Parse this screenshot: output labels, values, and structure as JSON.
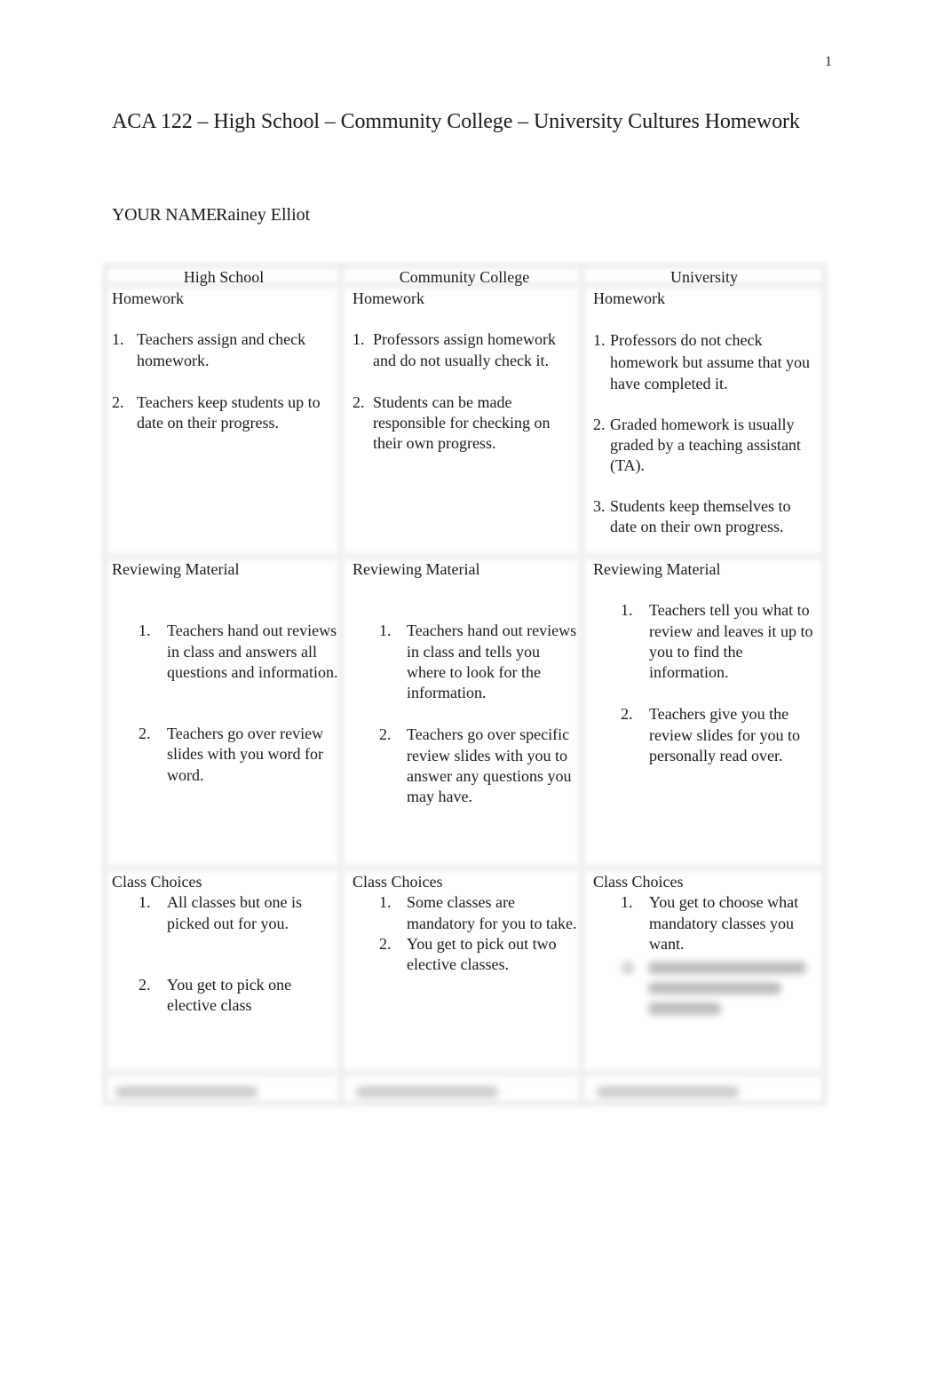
{
  "page_number": "1",
  "title": "ACA 122 – High School – Community College – University Cultures Homework",
  "name_label": "YOUR NAME:",
  "name_value": "Rainey Elliot",
  "table": {
    "columns": [
      "High School",
      "Community College",
      "University"
    ],
    "rows": [
      {
        "section": "Homework",
        "cells": [
          [
            "Teachers assign and check homework.",
            "Teachers keep students up to date on their progress."
          ],
          [
            "Professors assign homework and do not usually check it.",
            "Students can be made responsible for checking on their own progress."
          ],
          [
            "Professors do not check homework but assume that you have completed it.",
            "Graded homework is usually graded by a teaching assistant (TA).",
            "Students keep themselves to date on their own progress."
          ]
        ]
      },
      {
        "section": "Reviewing Material",
        "cells": [
          [
            "Teachers hand out reviews in class and answers all questions and information.",
            "Teachers go over review slides with you word for word."
          ],
          [
            "Teachers hand out reviews in class and tells you where to look for the information.",
            "Teachers go over specific review slides with you to answer any questions you may have."
          ],
          [
            "Teachers tell you what to review and leaves it up to you to find the information.",
            "Teachers give you the review slides for you to personally read over."
          ]
        ]
      },
      {
        "section": "Class Choices",
        "cells": [
          [
            "All classes but one is picked out for you.",
            "You get to pick one elective class"
          ],
          [
            "Some classes are mandatory for you to take.",
            "You get to pick out two elective classes."
          ],
          [
            "You get to choose what mandatory classes you want."
          ]
        ],
        "obscured_items": "University item 2 is blurred/unreadable"
      },
      {
        "section": "",
        "obscured": true
      }
    ]
  }
}
